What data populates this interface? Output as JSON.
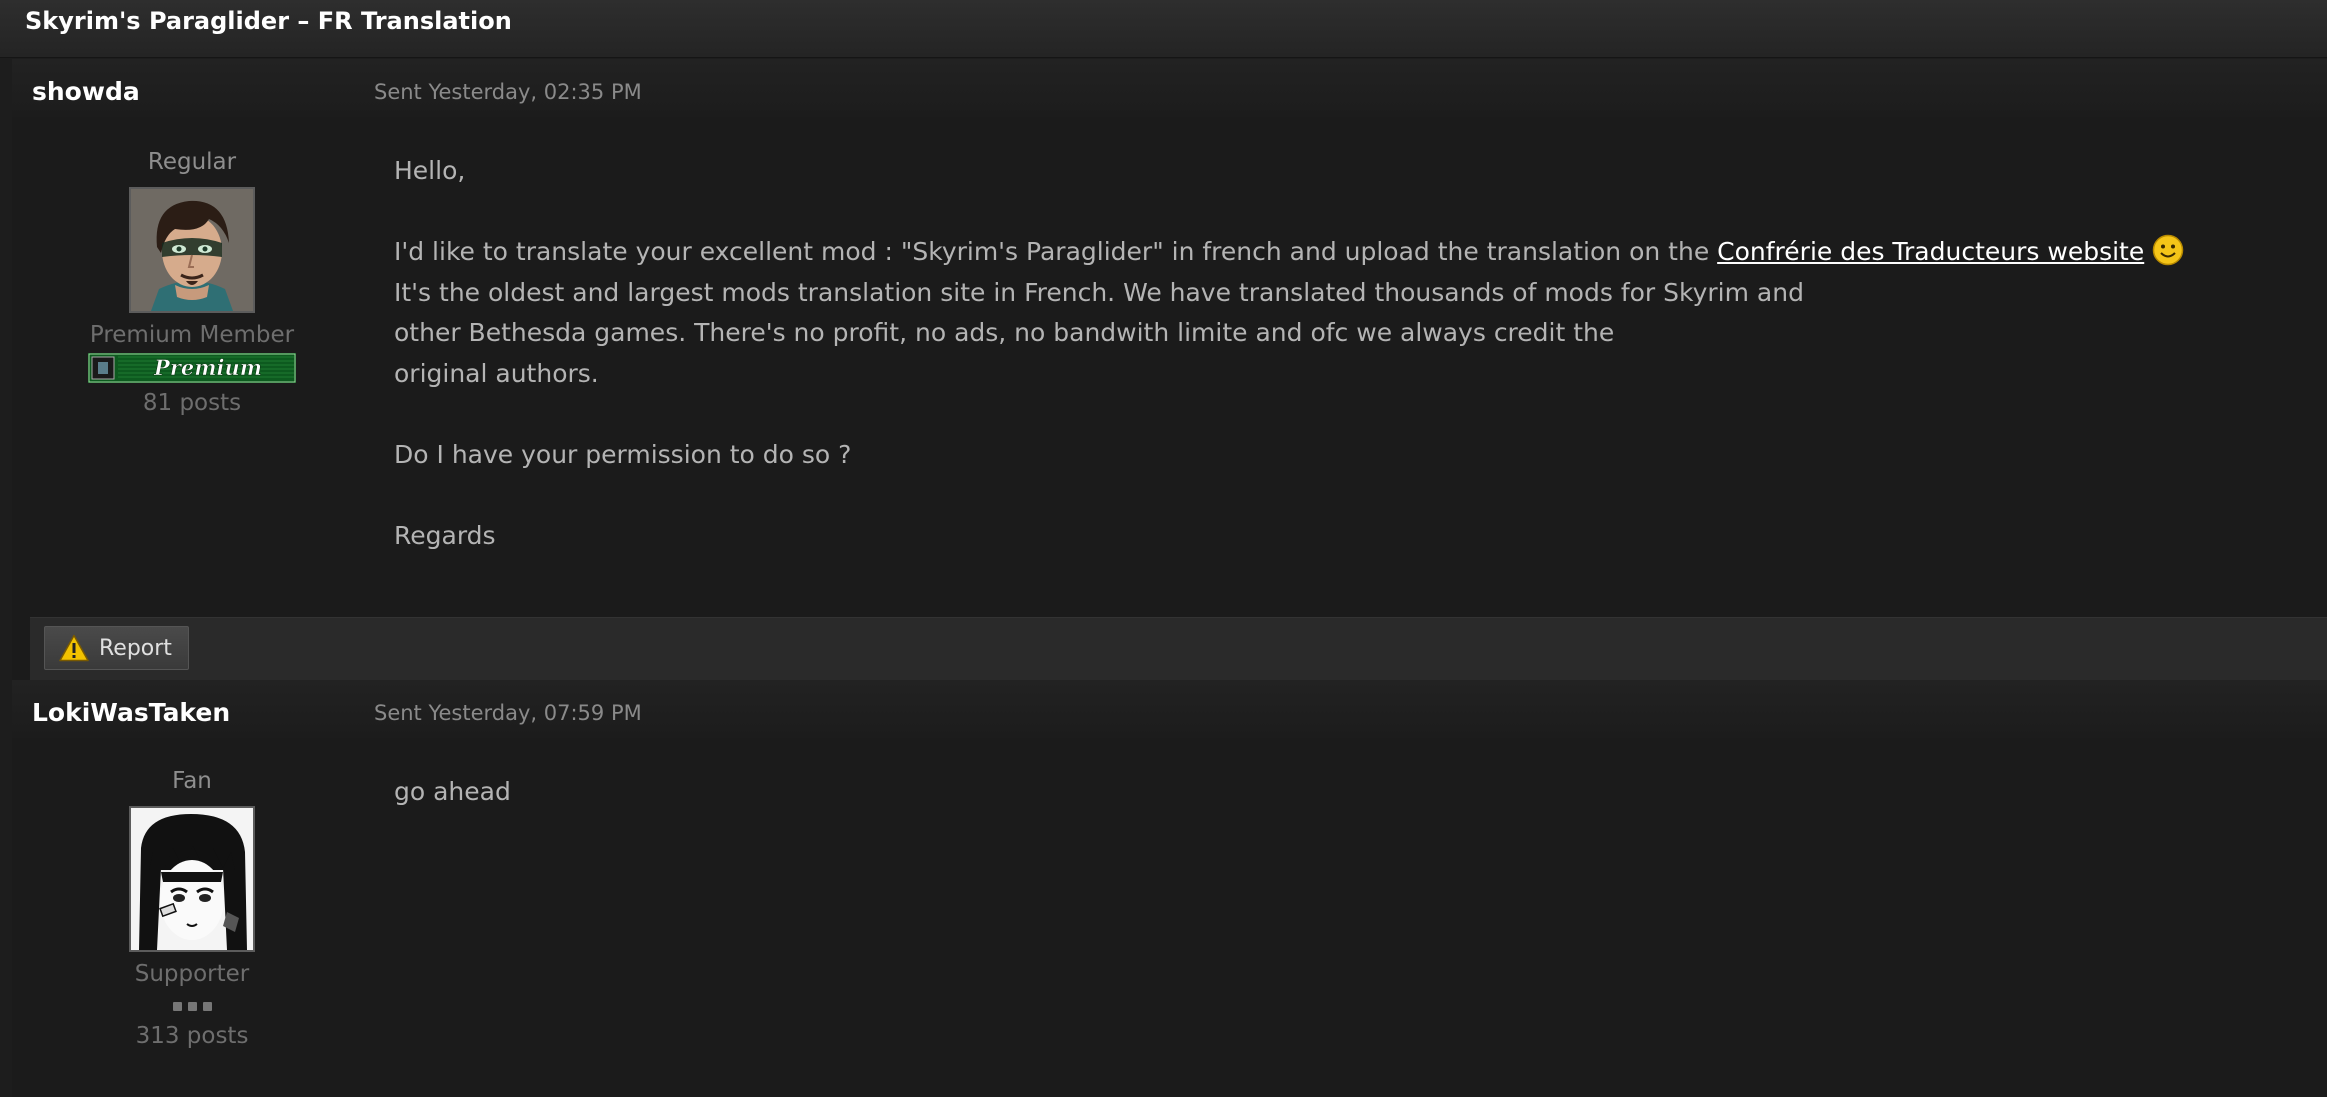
{
  "window": {
    "title": "Skyrim's Paraglider – FR Translation"
  },
  "messages": [
    {
      "author": "showda",
      "sent": "Sent Yesterday, 02:35 PM",
      "rank": "Regular",
      "group": "Premium Member",
      "badge": "Premium",
      "posts": "81 posts",
      "body": {
        "greeting": "Hello,",
        "line1_pre": "I'd like to translate your excellent mod : \"Skyrim's Paraglider\" in french and upload the translation on the ",
        "link_text": "Confrérie des Traducteurs website",
        "line2": "It's the oldest and largest mods translation site in French. We have translated thousands of mods for Skyrim and",
        "line3": "other Bethesda games. There's no profit, no ads, no bandwith limite and ofc we always credit the",
        "line4": "original authors.",
        "question": "Do I have your permission to do so ?",
        "closing": "Regards"
      },
      "icons": {
        "smiley": "smiley-icon",
        "avatar": "user-avatar"
      }
    },
    {
      "author": "LokiWasTaken",
      "sent": "Sent Yesterday, 07:59 PM",
      "rank": "Fan",
      "group": "Supporter",
      "posts": "313 posts",
      "body": {
        "text": "go ahead"
      },
      "icons": {
        "avatar": "user-avatar"
      }
    }
  ],
  "actions": {
    "report_label": "Report",
    "report_icon": "warning-icon"
  },
  "colors": {
    "link": "#ffffff",
    "warning": "#f2c200",
    "smiley": "#f5c518"
  }
}
